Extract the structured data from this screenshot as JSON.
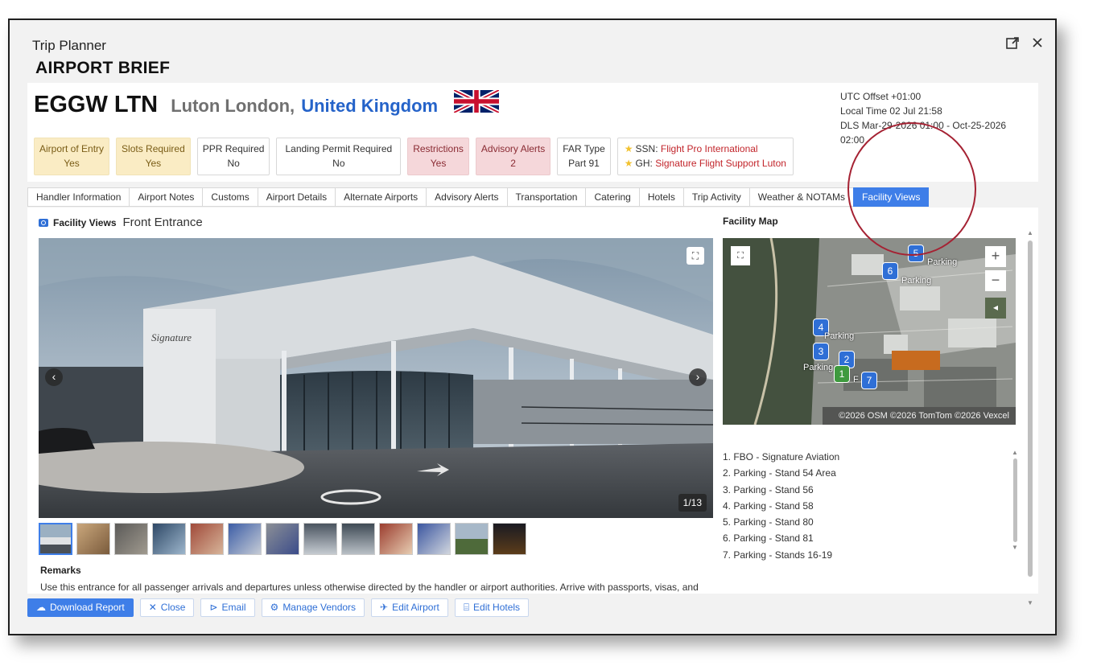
{
  "window": {
    "title": "Trip Planner",
    "subtitle": "AIRPORT BRIEF",
    "popout_icon": "external-link-icon",
    "close_icon": "close-icon"
  },
  "airport": {
    "icao": "EGGW",
    "iata": "LTN",
    "city": "Luton London,",
    "country": "United Kingdom",
    "flag_icon": "uk-flag-icon",
    "utc_offset": "UTC Offset +01:00",
    "local_time": "Local Time 02 Jul 21:58",
    "dls": "DLS Mar-29-2026 01:00 - Oct-25-2026 02:00"
  },
  "badges": [
    {
      "label": "Airport of Entry",
      "value": "Yes",
      "style": "yellow"
    },
    {
      "label": "Slots Required",
      "value": "Yes",
      "style": "yellow"
    },
    {
      "label": "PPR Required",
      "value": "No",
      "style": "plain"
    },
    {
      "label": "Landing Permit Required",
      "value": "No",
      "style": "plain"
    },
    {
      "label": "Restrictions",
      "value": "Yes",
      "style": "pink"
    },
    {
      "label": "Advisory Alerts",
      "value": "2",
      "style": "pink"
    },
    {
      "label": "FAR Type",
      "value": "Part 91",
      "style": "plain"
    }
  ],
  "vendors": [
    {
      "prefix": "SSN: ",
      "name": "Flight Pro International"
    },
    {
      "prefix": "GH: ",
      "name": "Signature Flight Support Luton"
    }
  ],
  "tabs": [
    {
      "label": "Handler Information",
      "active": false
    },
    {
      "label": "Airport Notes",
      "active": false
    },
    {
      "label": "Customs",
      "active": false
    },
    {
      "label": "Airport Details",
      "active": false
    },
    {
      "label": "Alternate Airports",
      "active": false
    },
    {
      "label": "Advisory Alerts",
      "active": false
    },
    {
      "label": "Transportation",
      "active": false
    },
    {
      "label": "Catering",
      "active": false
    },
    {
      "label": "Hotels",
      "active": false
    },
    {
      "label": "Trip Activity",
      "active": false
    },
    {
      "label": "Weather & NOTAMs",
      "active": false
    },
    {
      "label": "Facility Views",
      "active": true
    }
  ],
  "facility": {
    "heading": "Facility Views",
    "subheading": "Front Entrance",
    "counter": "1/13",
    "thumbnail_count": 13,
    "remarks_title": "Remarks",
    "remarks_text": "Use this entrance for all passenger arrivals and departures unless otherwise directed by the handler or airport authorities. Arrive with passports, visas, and"
  },
  "map": {
    "title": "Facility Map",
    "zoom_in": "+",
    "zoom_out": "−",
    "attribution": "©2026 OSM ©2026 TomTom ©2026 Vexcel",
    "pins": [
      {
        "num": "5",
        "label": "Parking"
      },
      {
        "num": "6",
        "label": "Parking"
      },
      {
        "num": "4",
        "label": "Parking"
      },
      {
        "num": "3",
        "label": "Parking"
      },
      {
        "num": "2",
        "label": ""
      },
      {
        "num": "1",
        "label": ""
      },
      {
        "num": "7",
        "label": "F"
      }
    ]
  },
  "poi_list": [
    "1. FBO - Signature Aviation",
    "2. Parking - Stand 54 Area",
    "3. Parking - Stand 56",
    "4. Parking - Stand 58",
    "5. Parking - Stand 80",
    "6. Parking - Stand 81",
    "7. Parking - Stands 16-19"
  ],
  "footer": {
    "download": "Download Report",
    "close": "Close",
    "email": "Email",
    "vendors": "Manage Vendors",
    "edit_airport": "Edit Airport",
    "edit_hotels": "Edit Hotels"
  },
  "colors": {
    "accent": "#3e7ee8",
    "yellow_badge": "#faecc4",
    "pink_badge": "#f5d7da",
    "annotation_circle": "#a52233"
  }
}
